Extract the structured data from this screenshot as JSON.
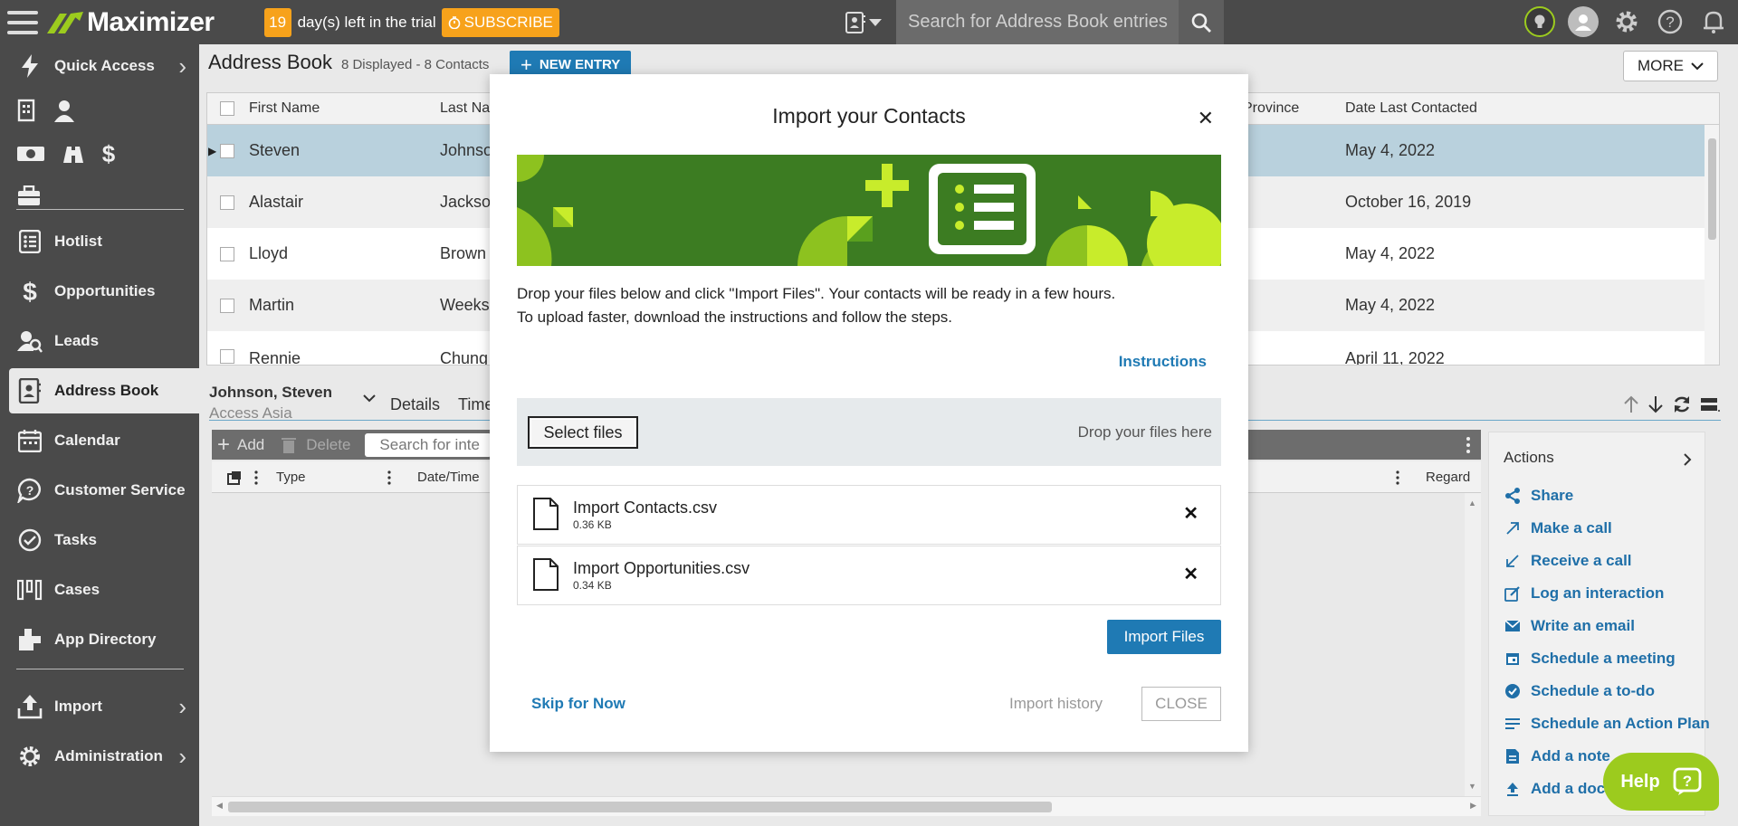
{
  "app": {
    "name": "Maximizer"
  },
  "trial": {
    "days": "19",
    "text": "day(s) left in the trial",
    "subscribe": "SUBSCRIBE"
  },
  "search": {
    "placeholder": "Search for Address Book entries..."
  },
  "sidebar": {
    "quick_access": "Quick Access",
    "items": [
      {
        "label": "Hotlist",
        "icon": "hotlist-icon"
      },
      {
        "label": "Opportunities",
        "icon": "dollar-icon"
      },
      {
        "label": "Leads",
        "icon": "leads-icon"
      },
      {
        "label": "Address Book",
        "icon": "address-book-icon"
      },
      {
        "label": "Calendar",
        "icon": "calendar-icon"
      },
      {
        "label": "Customer Service",
        "icon": "customer-service-icon"
      },
      {
        "label": "Tasks",
        "icon": "tasks-icon"
      },
      {
        "label": "Cases",
        "icon": "cases-icon"
      },
      {
        "label": "App Directory",
        "icon": "app-directory-icon"
      }
    ],
    "import": "Import",
    "administration": "Administration"
  },
  "address_book": {
    "title": "Address Book",
    "count": "8 Displayed - 8 Contacts",
    "new_entry": "NEW ENTRY",
    "more": "MORE",
    "columns": {
      "first": "First Name",
      "last": "Last Na",
      "province": "Province",
      "date": "Date Last Contacted"
    },
    "rows": [
      {
        "first": "Steven",
        "last": "Johnso",
        "date": "May 4, 2022"
      },
      {
        "first": "Alastair",
        "last": "Jackso",
        "date": "October 16, 2019"
      },
      {
        "first": "Lloyd",
        "last": "Brown",
        "date": "May 4, 2022"
      },
      {
        "first": "Martin",
        "last": "Weeks",
        "date": "May 4, 2022"
      },
      {
        "first": "Rennie",
        "last": "Chung",
        "date": "April 11, 2022"
      }
    ]
  },
  "detail": {
    "name": "Johnson, Steven",
    "company": "Access Asia",
    "tabs": [
      "Details",
      "Time"
    ],
    "add": "Add",
    "delete": "Delete",
    "search_placeholder": "Search for inte",
    "col_type": "Type",
    "col_date": "Date/Time",
    "col_regarding": "Regard"
  },
  "actions": {
    "title": "Actions",
    "items": [
      {
        "label": "Share",
        "icon": "share-icon"
      },
      {
        "label": "Make a call",
        "icon": "outgoing-call-icon"
      },
      {
        "label": "Receive a call",
        "icon": "incoming-call-icon"
      },
      {
        "label": "Log an interaction",
        "icon": "edit-icon"
      },
      {
        "label": "Write an email",
        "icon": "email-icon"
      },
      {
        "label": "Schedule a meeting",
        "icon": "calendar-icon"
      },
      {
        "label": "Schedule a to-do",
        "icon": "check-circle-icon"
      },
      {
        "label": "Schedule an Action Plan",
        "icon": "list-icon"
      },
      {
        "label": "Add a note",
        "icon": "note-icon"
      },
      {
        "label": "Add a doc",
        "icon": "upload-icon"
      }
    ]
  },
  "help": {
    "label": "Help"
  },
  "modal": {
    "title": "Import your Contacts",
    "description_line1": "Drop your files below and click \"Import Files\". Your contacts will be ready in a few hours.",
    "description_line2": "To upload faster, download the instructions and follow the steps.",
    "instructions": "Instructions",
    "select_files": "Select files",
    "drop_text": "Drop your files here",
    "files": [
      {
        "name": "Import Contacts.csv",
        "size": "0.36 KB"
      },
      {
        "name": "Import Opportunities.csv",
        "size": "0.34 KB"
      }
    ],
    "import_files": "Import Files",
    "skip": "Skip for Now",
    "history": "Import history",
    "close": "CLOSE"
  },
  "colors": {
    "accent": "#1f7ab4",
    "trial": "#f7a21b",
    "banner": "#3c7c22",
    "banner_light": "#8dc21f",
    "help": "#9ccb1e",
    "sidebar": "#4a4a4a"
  }
}
